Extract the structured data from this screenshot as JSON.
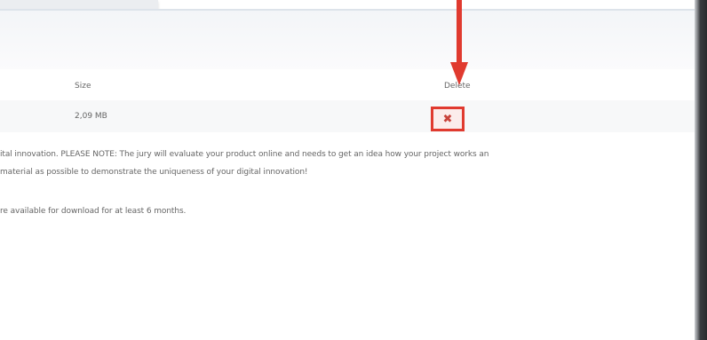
{
  "table": {
    "headers": {
      "size": "Size",
      "delete": "Delete"
    },
    "row": {
      "size": "2,09 MB",
      "delete_icon": "close-x-icon",
      "delete_symbol": "✖"
    }
  },
  "notes": {
    "line1": "ital innovation. PLEASE NOTE: The jury will evaluate your product online and needs to get an idea how your project works an",
    "line2": "material as possible to demonstrate the uniqueness of your digital innovation!",
    "line3": "re available for download for at least 6 months."
  },
  "colors": {
    "highlight": "#e03a2f",
    "delete_icon": "#c8423a"
  }
}
